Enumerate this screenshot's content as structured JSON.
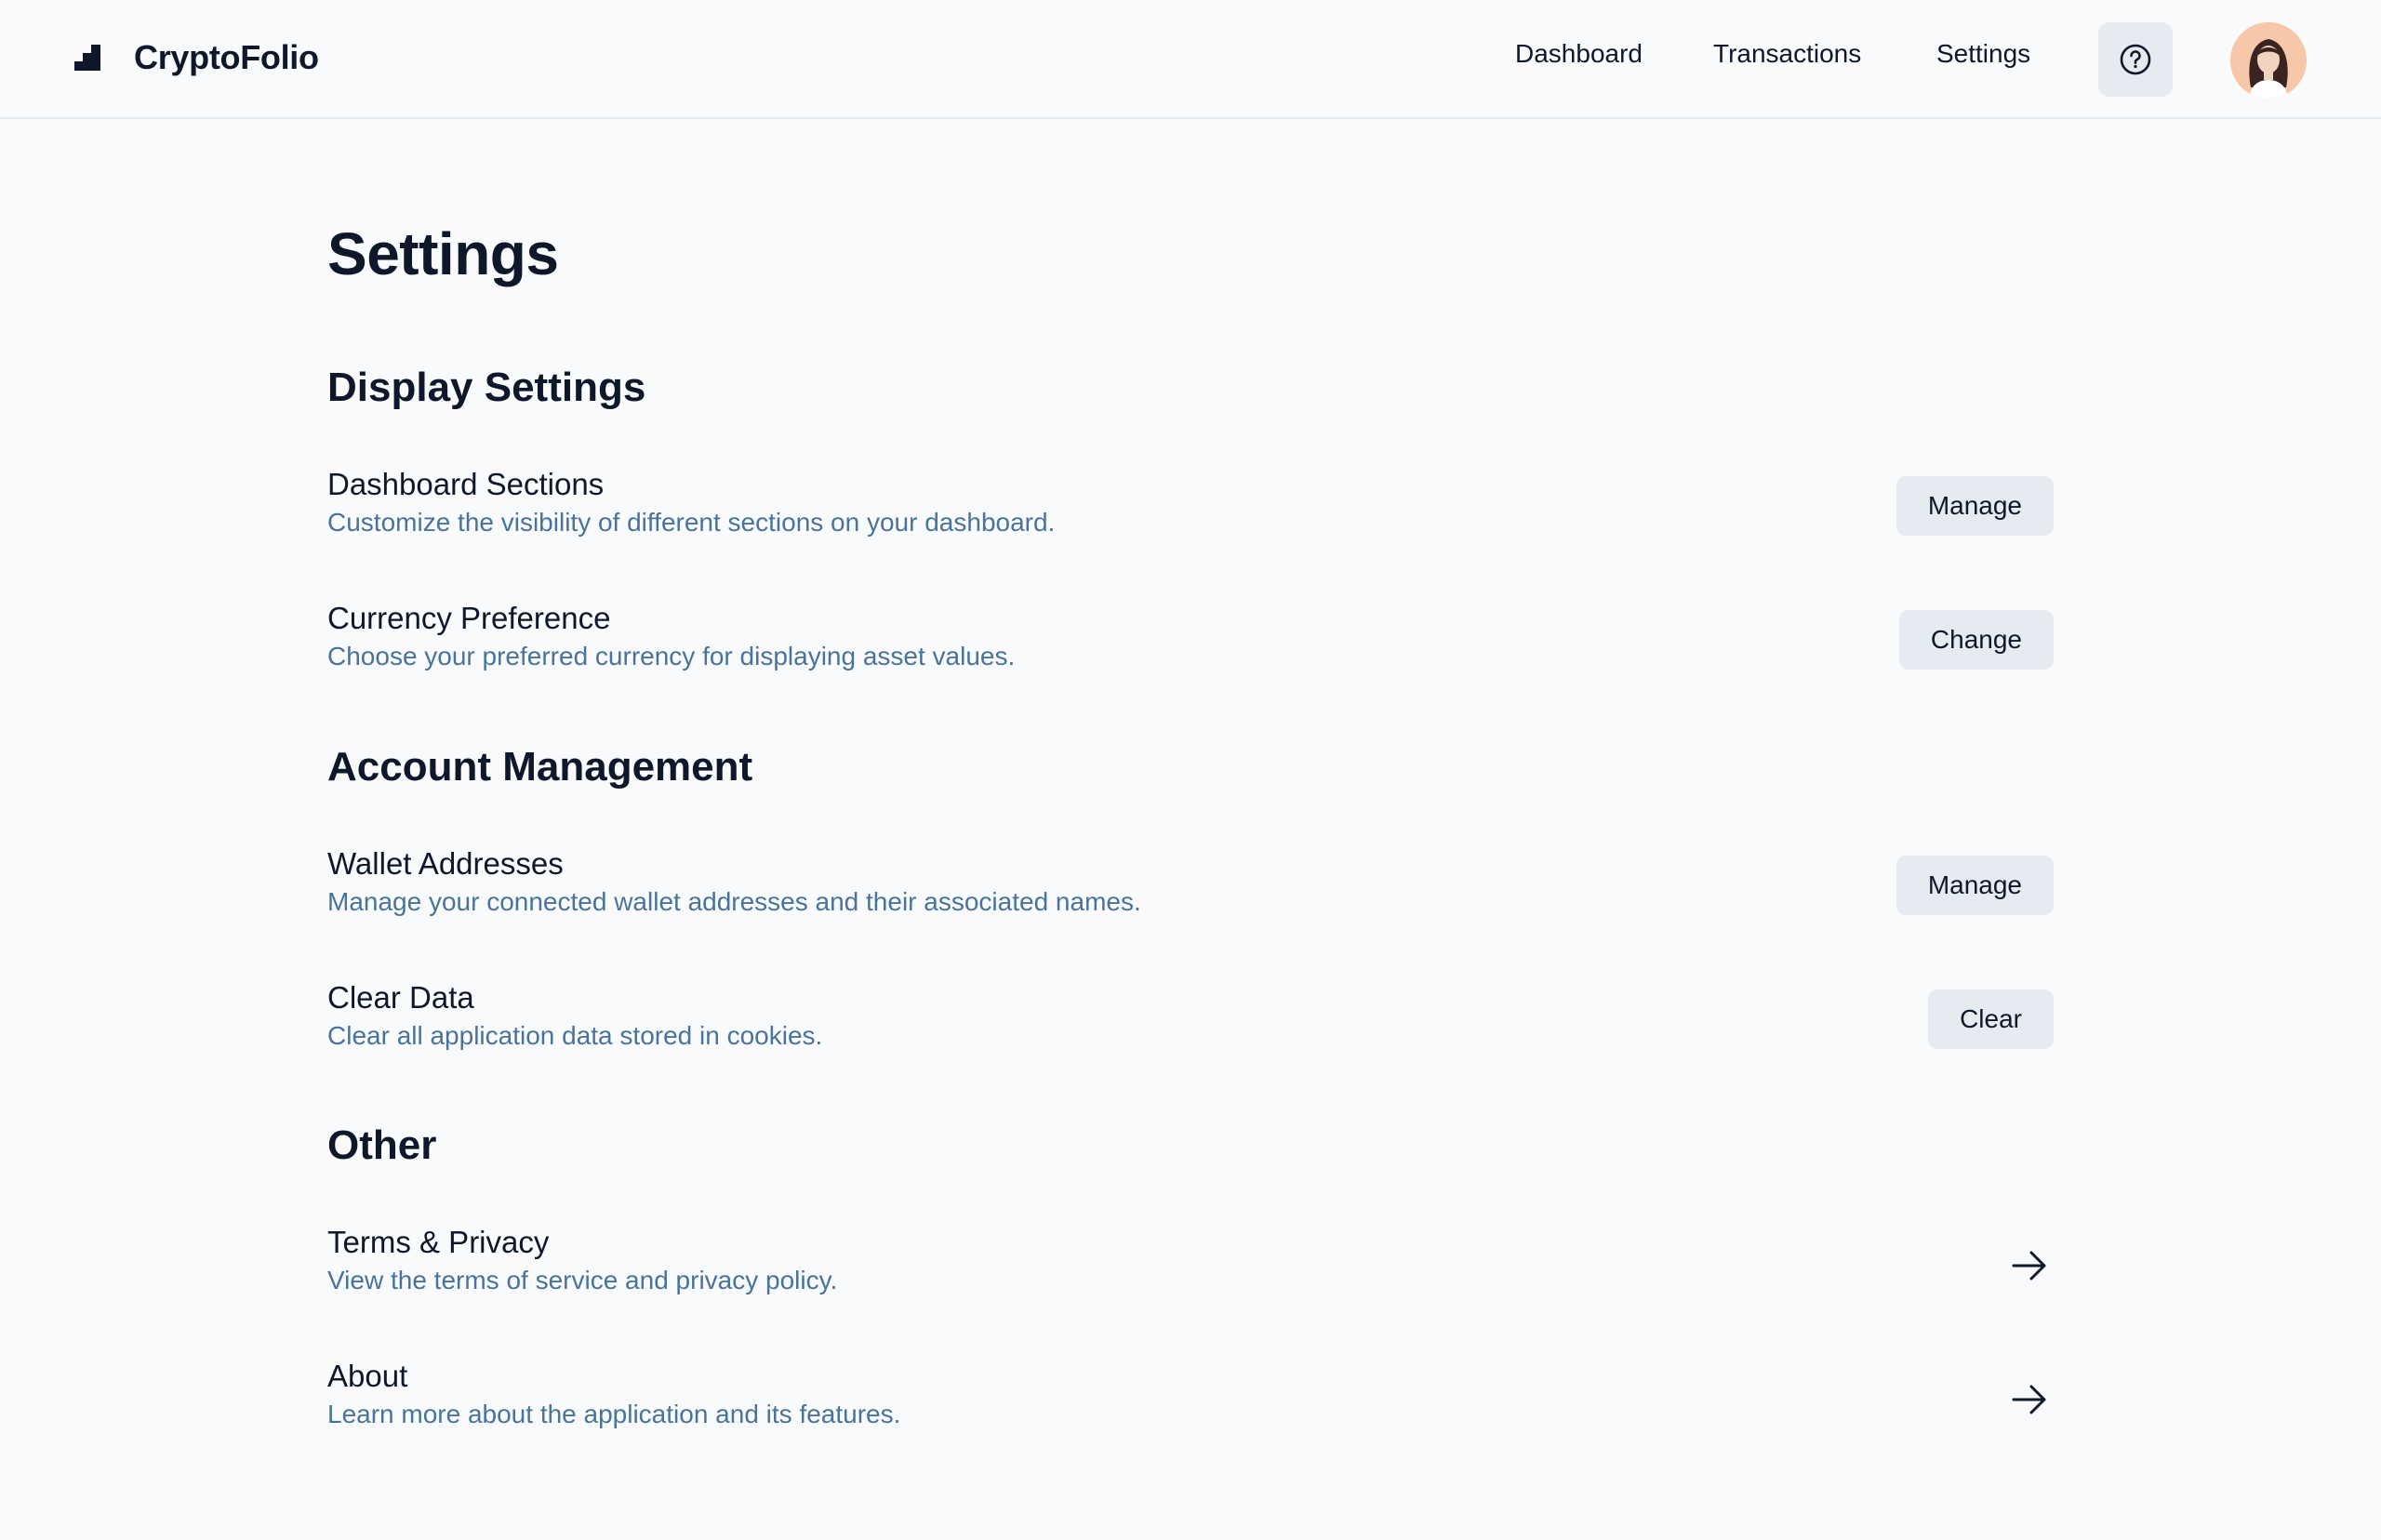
{
  "header": {
    "brand": "CryptoFolio",
    "nav": [
      "Dashboard",
      "Transactions",
      "Settings"
    ],
    "help_icon": "help-circle-icon",
    "avatar_icon": "user-avatar"
  },
  "main": {
    "page_title": "Settings",
    "sections": [
      {
        "title": "Display Settings",
        "rows": [
          {
            "title": "Dashboard Sections",
            "description": "Customize the visibility of different sections on your dashboard.",
            "action": "Manage"
          },
          {
            "title": "Currency Preference",
            "description": "Choose your preferred currency for displaying asset values.",
            "action": "Change"
          }
        ]
      },
      {
        "title": "Account Management",
        "rows": [
          {
            "title": "Wallet Addresses",
            "description": "Manage your connected wallet addresses and their associated names.",
            "action": "Manage"
          },
          {
            "title": "Clear Data",
            "description": "Clear all application data stored in cookies.",
            "action": "Clear"
          }
        ]
      },
      {
        "title": "Other",
        "rows": [
          {
            "title": "Terms & Privacy",
            "description": "View the terms of service and privacy policy.",
            "action_icon": "arrow-right-icon"
          },
          {
            "title": "About",
            "description": "Learn more about the application and its features.",
            "action_icon": "arrow-right-icon"
          }
        ]
      }
    ]
  },
  "colors": {
    "background": "#f8fafc",
    "text": "#0f172a",
    "muted_text": "#4a739c",
    "button_bg": "#e6ebf1",
    "border": "#e5e9ef"
  }
}
